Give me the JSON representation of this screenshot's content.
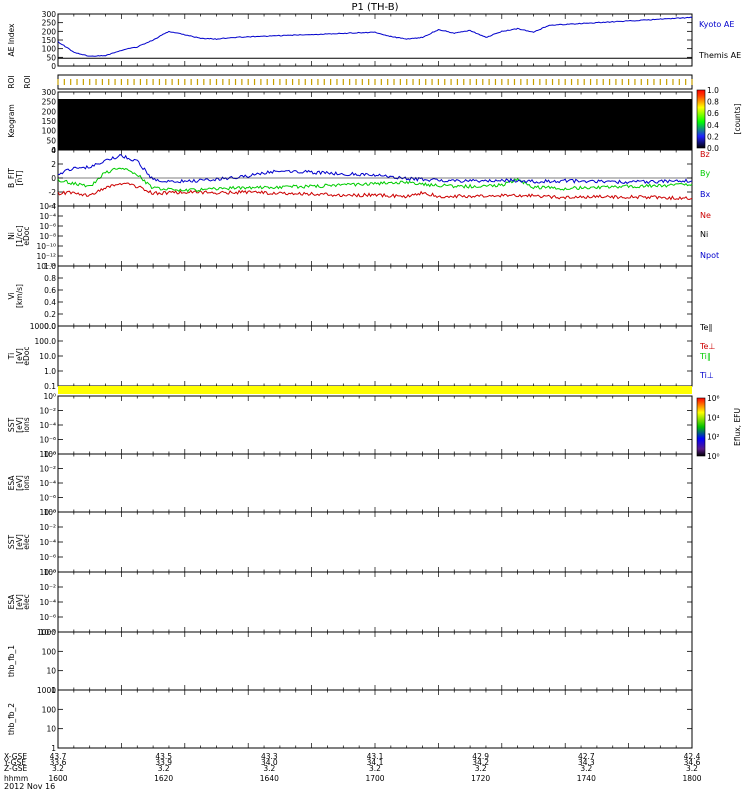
{
  "title": "P1 (TH-B)",
  "date": "2012 Nov 16",
  "time_axis": {
    "ticks": [
      "1600",
      "1620",
      "1640",
      "1700",
      "1720",
      "1740",
      "1800"
    ],
    "row_labels": [
      "X-GSE",
      "Y-GSE",
      "Z-GSE",
      "hhmm"
    ],
    "rows": [
      [
        "43.7",
        "43.5",
        "43.3",
        "43.1",
        "42.9",
        "42.7",
        "42.4"
      ],
      [
        "33.6",
        "33.9",
        "34.0",
        "34.1",
        "34.2",
        "34.3",
        "34.6"
      ],
      [
        "3.2",
        "3.2",
        "3.2",
        "3.2",
        "3.2",
        "3.2",
        "3.2"
      ]
    ]
  },
  "colors": {
    "red": "#cc0000",
    "green": "#00cc00",
    "blue": "#0000cc",
    "yellow": "#ffff00",
    "black": "#000000"
  },
  "chart_data": [
    {
      "type": "line",
      "panel": "ae",
      "ylabel": "AE Index",
      "ylim": [
        0,
        300
      ],
      "ticks": [
        "0",
        "50",
        "100",
        "150",
        "200",
        "250",
        "300"
      ],
      "x_range": [
        1600,
        1800
      ],
      "series": [
        {
          "name": "Kyoto AE",
          "color": "#0000cc",
          "x": [
            1600,
            1605,
            1610,
            1615,
            1620,
            1625,
            1630,
            1635,
            1640,
            1645,
            1650,
            1655,
            1700,
            1705,
            1710,
            1715,
            1720,
            1725,
            1730,
            1735,
            1740,
            1745,
            1750,
            1755,
            1800
          ],
          "values": [
            140,
            80,
            55,
            60,
            90,
            110,
            150,
            200,
            180,
            160,
            155,
            165,
            195,
            170,
            155,
            165,
            210,
            190,
            205,
            165,
            200,
            215,
            195,
            235,
            280
          ]
        },
        {
          "name": "Themis AE",
          "color": "#000000",
          "x": [
            1600,
            1610,
            1620,
            1640,
            1660,
            1680,
            1700,
            1720,
            1740,
            1760,
            1780,
            1800
          ],
          "values": [
            45,
            45,
            45,
            45,
            45,
            45,
            45,
            45,
            45,
            45,
            45,
            45
          ]
        }
      ]
    },
    {
      "type": "roi",
      "panel": "roi",
      "ylabel": "ROI"
    },
    {
      "type": "heatmap",
      "panel": "keogram",
      "ylabel": "Keogram",
      "ylim": [
        0,
        300
      ],
      "ticks": [
        "0",
        "50",
        "100",
        "150",
        "200",
        "250",
        "300"
      ],
      "colorbar_ticks": [
        "0.0",
        "0.2",
        "0.4",
        "0.6",
        "0.8",
        "1.0"
      ],
      "colorbar_label": "[counts]"
    },
    {
      "type": "line",
      "panel": "bfit",
      "ylabel": "B_FIT",
      "ylabel2": "[nT]",
      "ylim": [
        -4,
        4
      ],
      "ticks": [
        "-4",
        "-2",
        "0",
        "2",
        "4"
      ],
      "x_range": [
        1600,
        1800
      ],
      "series": [
        {
          "name": "Bz",
          "color": "#cc0000",
          "x": [
            1600,
            1605,
            1610,
            1615,
            1620,
            1625,
            1630,
            1640,
            1650,
            1660,
            1670,
            1680,
            1690,
            1700,
            1710,
            1715,
            1720,
            1730,
            1740,
            1750,
            1760,
            1770,
            1780,
            1790,
            1800
          ],
          "values": [
            -2.2,
            -2.0,
            -2.6,
            -1.4,
            -0.8,
            -1.2,
            -2.2,
            -2.0,
            -2.1,
            -2.0,
            -2.2,
            -2.3,
            -2.5,
            -2.4,
            -2.7,
            -2.1,
            -2.6,
            -2.6,
            -2.5,
            -2.5,
            -2.8,
            -2.7,
            -2.7,
            -2.8,
            -2.9
          ]
        },
        {
          "name": "By",
          "color": "#00cc00",
          "x": [
            1600,
            1605,
            1610,
            1615,
            1620,
            1625,
            1630,
            1640,
            1650,
            1660,
            1670,
            1680,
            1690,
            1700,
            1710,
            1715,
            1720,
            1730,
            1740,
            1745,
            1750,
            1760,
            1770,
            1780,
            1790,
            1800
          ],
          "values": [
            -0.3,
            -0.8,
            -1.2,
            0.8,
            1.5,
            0.5,
            -1.5,
            -1.8,
            -1.5,
            -1.4,
            -1.3,
            -1.2,
            -1.0,
            -0.8,
            -0.6,
            -0.9,
            -1.1,
            -1.2,
            -1.0,
            -0.2,
            -1.3,
            -1.5,
            -1.3,
            -1.2,
            -1.1,
            -0.9
          ]
        },
        {
          "name": "Bx",
          "color": "#0000cc",
          "x": [
            1600,
            1605,
            1610,
            1615,
            1620,
            1625,
            1630,
            1640,
            1650,
            1660,
            1670,
            1680,
            1690,
            1700,
            1710,
            1720,
            1730,
            1740,
            1750,
            1760,
            1770,
            1780,
            1790,
            1800
          ],
          "values": [
            0.5,
            1.4,
            1.5,
            2.6,
            3.2,
            2.4,
            -0.3,
            -0.5,
            -0.2,
            0.3,
            1.1,
            0.8,
            0.6,
            0.4,
            -0.1,
            -0.3,
            -0.4,
            -0.3,
            -0.5,
            -0.4,
            -0.5,
            -0.6,
            -0.5,
            -0.4
          ]
        }
      ]
    },
    {
      "type": "line",
      "panel": "ni",
      "ylabel": "Ni",
      "ylabel2": "[1/cc]",
      "ylabel3": "eDoc",
      "ticks": [
        "10⁻¹⁴",
        "10⁻¹²",
        "10⁻¹⁰",
        "10⁻⁸",
        "10⁻⁶",
        "10⁻⁴",
        "10⁻²"
      ],
      "legend": [
        {
          "name": "Ne",
          "color": "#cc0000"
        },
        {
          "name": "Ni",
          "color": "#000000"
        },
        {
          "name": "Npot",
          "color": "#0000cc"
        }
      ]
    },
    {
      "type": "line",
      "panel": "vi",
      "ylabel": "Vi",
      "ylabel2": "[km/s]",
      "ticks": [
        "0.0",
        "0.2",
        "0.4",
        "0.6",
        "0.8",
        "1.0"
      ]
    },
    {
      "type": "line",
      "panel": "ti",
      "ylabel": "Ti",
      "ylabel2": "[eV]",
      "ylabel3": "eDoc",
      "ticks": [
        "0.1",
        "1.0",
        "10.0",
        "100.0",
        "1000.0"
      ],
      "legend": [
        {
          "name": "Te∥",
          "color": "#000000"
        },
        {
          "name": "Te⊥",
          "color": "#cc0000"
        },
        {
          "name": "Ti∥",
          "color": "#00cc00"
        },
        {
          "name": "Ti⊥",
          "color": "#0000cc"
        }
      ]
    },
    {
      "type": "band",
      "panel": "band"
    },
    {
      "type": "heatmap",
      "panel": "sst1",
      "ylabel": "SST",
      "ylabel2": "[eV]",
      "ylabel3": "ions",
      "ticks": [
        "10⁻⁸",
        "10⁻⁶",
        "10⁻⁴",
        "10⁻²",
        "10⁰"
      ],
      "colorbar_ticks": [
        "10⁰",
        "10²",
        "10⁴",
        "10⁶"
      ],
      "colorbar_label": "Eflux, EFU"
    },
    {
      "type": "heatmap",
      "panel": "esa1",
      "ylabel": "ESA",
      "ylabel2": "[eV]",
      "ylabel3": "ions",
      "ticks": [
        "10⁻⁸",
        "10⁻⁶",
        "10⁻⁴",
        "10⁻²",
        "10⁰"
      ]
    },
    {
      "type": "heatmap",
      "panel": "sst2",
      "ylabel": "SST",
      "ylabel2": "[eV]",
      "ylabel3": "elec",
      "ticks": [
        "10⁻⁸",
        "10⁻⁶",
        "10⁻⁴",
        "10⁻²",
        "10⁰"
      ]
    },
    {
      "type": "heatmap",
      "panel": "esa2",
      "ylabel": "ESA",
      "ylabel2": "[eV]",
      "ylabel3": "elec",
      "ticks": [
        "10⁻⁸",
        "10⁻⁶",
        "10⁻⁴",
        "10⁻²",
        "10⁰"
      ]
    },
    {
      "type": "line",
      "panel": "fb1",
      "ylabel": "thb_fb_1",
      "ticks": [
        "1",
        "10",
        "100",
        "1000"
      ]
    },
    {
      "type": "line",
      "panel": "fb2",
      "ylabel": "thb_fb_2",
      "ticks": [
        "1",
        "10",
        "100",
        "1000"
      ]
    }
  ]
}
